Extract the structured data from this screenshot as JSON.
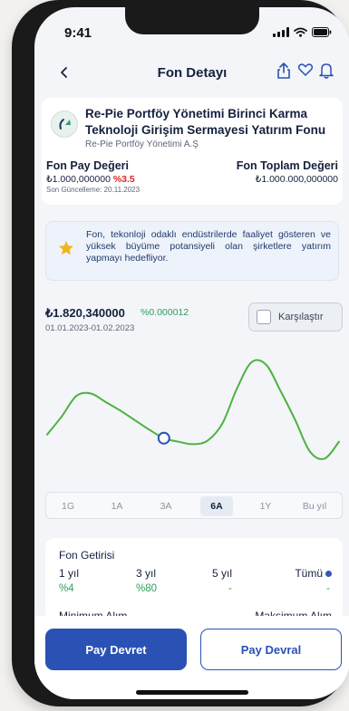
{
  "status_bar": {
    "time": "9:41"
  },
  "nav": {
    "back_icon": "chevron-left-icon",
    "title": "Fon Detayı"
  },
  "fund": {
    "name": "Re-Pie Portföy Yönetimi Birinci Karma Teknoloji Girişim Sermayesi Yatırım Fonu",
    "company": "Re-Pie Portföy Yönetimi A.Ş",
    "unit_value_label": "Fon Pay Değeri",
    "unit_value": "₺1.000,000000",
    "unit_change": "%3.5",
    "updated": "Son Güncelleme: 20.11.2023",
    "total_value_label": "Fon Toplam Değeri",
    "total_value": "₺1.000.000,000000"
  },
  "info": {
    "text": "Fon, tekonloji odaklı endüstrilerde faaliyet gösteren ve yüksek büyüme potansiyeli olan şirketlere yatırım yapmayı hedefliyor."
  },
  "price": {
    "value": "₺1.820,340000",
    "change": "%0.000012",
    "range": "01.01.2023-01.02.2023"
  },
  "compare": {
    "label": "Karşılaştır"
  },
  "chart_data": {
    "type": "line",
    "title": "",
    "xlabel": "",
    "ylabel": "",
    "grid": false,
    "x": [
      0,
      1,
      2,
      3,
      4,
      5,
      6,
      7,
      8,
      9,
      10,
      11,
      12,
      13,
      14,
      15,
      16,
      17,
      18,
      19,
      20
    ],
    "series": [
      {
        "values": [
          28,
          43,
          60,
          62,
          55,
          48,
          40,
          32,
          25,
          22,
          20,
          23,
          37,
          66,
          88,
          86,
          64,
          40,
          14,
          8,
          22
        ]
      }
    ],
    "ylim": [
      0,
      100
    ],
    "highlight_index": 8,
    "line_color": "#4cb33e",
    "marker_color": "#2a52b5"
  },
  "range_tabs": {
    "items": [
      {
        "label": "1G",
        "active": false
      },
      {
        "label": "1A",
        "active": false
      },
      {
        "label": "3A",
        "active": false
      },
      {
        "label": "6A",
        "active": true
      },
      {
        "label": "1Y",
        "active": false
      },
      {
        "label": "Bu yıl",
        "active": false
      }
    ]
  },
  "returns": {
    "title": "Fon Getirisi",
    "columns": [
      {
        "label": "1 yıl",
        "value": "%4"
      },
      {
        "label": "3 yıl",
        "value": "%80"
      },
      {
        "label": "5 yıl",
        "value": "-"
      },
      {
        "label": "Tümü",
        "value": "-"
      }
    ],
    "min_label": "Minimum Alım",
    "max_label": "Maksimum Alım"
  },
  "actions": {
    "primary": "Pay Devret",
    "secondary": "Pay Devral"
  },
  "colors": {
    "primary": "#2a52b5",
    "positive": "#2e9e5b",
    "negative": "#e02424",
    "chart_line": "#4cb33e"
  }
}
